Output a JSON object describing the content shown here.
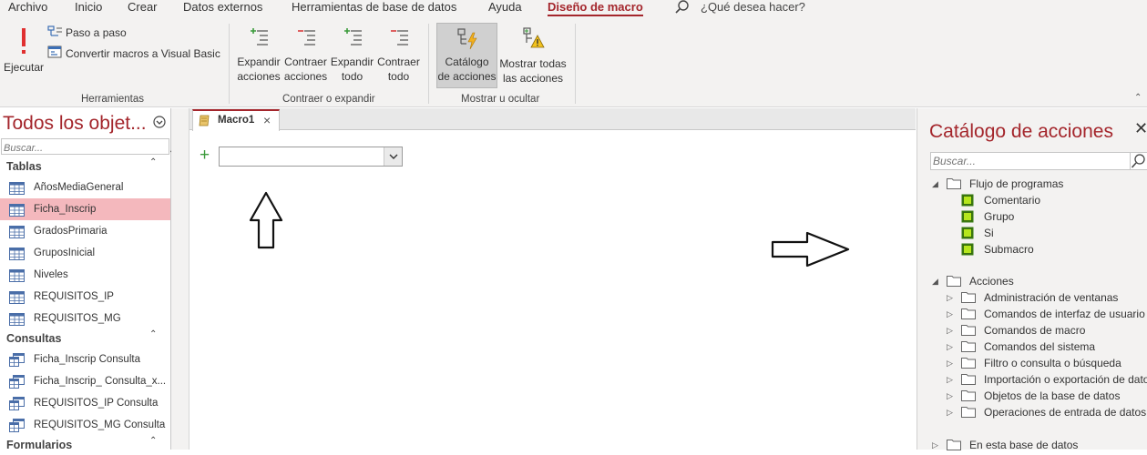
{
  "menu": {
    "tabs": [
      "Archivo",
      "Inicio",
      "Crear",
      "Datos externos",
      "Herramientas de base de datos",
      "Ayuda",
      "Diseño de macro"
    ],
    "search_placeholder": "¿Qué desea hacer?"
  },
  "ribbon": {
    "run_label": "Ejecutar",
    "step_label": "Paso a paso",
    "convert_label": "Convertir macros a Visual Basic",
    "tools_group": "Herramientas",
    "expand_actions_1": "Expandir",
    "expand_actions_2": "acciones",
    "collapse_actions_1": "Contraer",
    "collapse_actions_2": "acciones",
    "expand_all_1": "Expandir",
    "expand_all_2": "todo",
    "collapse_all_1": "Contraer",
    "collapse_all_2": "todo",
    "expand_group": "Contraer o expandir",
    "catalog_1": "Catálogo",
    "catalog_2": "de acciones",
    "show_all_1": "Mostrar todas",
    "show_all_2": "las acciones",
    "show_group": "Mostrar u ocultar"
  },
  "nav": {
    "title": "Todos los objet...",
    "search_placeholder": "Buscar...",
    "sections": [
      {
        "label": "Tablas",
        "items": [
          "AñosMediaGeneral",
          "Ficha_Inscrip",
          "GradosPrimaria",
          "GruposInicial",
          "Niveles",
          "REQUISITOS_IP",
          "REQUISITOS_MG"
        ]
      },
      {
        "label": "Consultas",
        "items": [
          "Ficha_Inscrip Consulta",
          "Ficha_Inscrip_ Consulta_x...",
          "REQUISITOS_IP Consulta",
          "REQUISITOS_MG Consulta"
        ]
      },
      {
        "label": "Formularios",
        "items": []
      }
    ],
    "selected": "Ficha_Inscrip"
  },
  "document": {
    "tab_label": "Macro1",
    "combo_value": ""
  },
  "catalog": {
    "title": "Catálogo de acciones",
    "search_placeholder": "Buscar...",
    "flow_label": "Flujo de programas",
    "flow_items": [
      "Comentario",
      "Grupo",
      "Si",
      "Submacro"
    ],
    "actions_label": "Acciones",
    "action_folders": [
      "Administración de ventanas",
      "Comandos de interfaz de usuario",
      "Comandos de macro",
      "Comandos del sistema",
      "Filtro o consulta o búsqueda",
      "Importación o exportación de datos",
      "Objetos de la base de datos",
      "Operaciones de entrada de datos"
    ],
    "db_label": "En esta base de datos"
  },
  "colors": {
    "accent": "#a4262c",
    "selected_row": "#f4b8bd",
    "ribbon_bg": "#f3f2f1"
  }
}
